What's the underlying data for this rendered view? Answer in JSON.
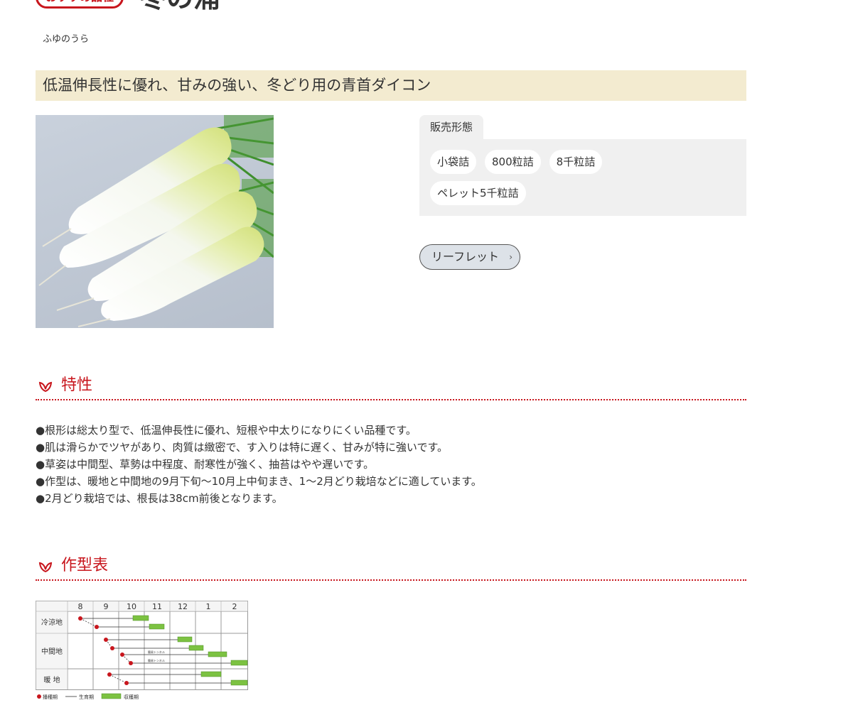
{
  "header": {
    "badge": "おすすめ品種",
    "product_name": "冬の浦",
    "reading": "ふゆのうら"
  },
  "catch_copy": "低温伸長性に優れ、甘みの強い、冬どり用の青首ダイコン",
  "sales": {
    "tab_label": "販売形態",
    "forms": [
      "小袋詰",
      "800粒詰",
      "8千粒詰",
      "ペレット5千粒詰"
    ]
  },
  "leaflet": {
    "label": "リーフレット"
  },
  "features": {
    "heading": "特性",
    "items": [
      "●根形は総太り型で、低温伸長性に優れ、短根や中太りになりにくい品種です。",
      "●肌は滑らかでツヤがあり、肉質は緻密で、す入りは特に遅く、甘みが特に強いです。",
      "●草姿は中間型、草勢は中程度、耐寒性が強く、抽苔はやや遅いです。",
      "●作型は、暖地と中間地の9月下旬〜10月上中旬まき、1〜2月どり栽培などに適しています。",
      "●2月どり栽培では、根長は38cm前後となります。"
    ]
  },
  "cropping": {
    "heading": "作型表",
    "months": [
      "8",
      "9",
      "10",
      "11",
      "12",
      "1",
      "2"
    ],
    "regions": [
      "冷涼地",
      "中間地",
      "暖 地"
    ],
    "legend": [
      "播種期",
      "生育期",
      "収穫期"
    ],
    "tunnel_label": "簡易トンネル"
  },
  "colors": {
    "accent_red": "#c8161d",
    "catch_bg": "#f3ebd0",
    "panel_bg": "#f0f0f0",
    "harvest_green": "#7cc242"
  },
  "icons": {
    "section": "leaf-icon",
    "leaflet_arrow": "chevron-right-icon"
  }
}
